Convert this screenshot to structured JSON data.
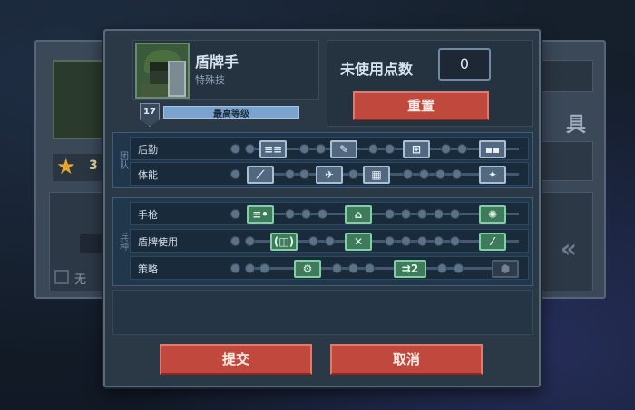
{
  "background": {
    "star_count": "3",
    "none_label": "无",
    "right_heading": "具"
  },
  "unit": {
    "name": "盾牌手",
    "subtitle": "特殊技",
    "level": "17",
    "level_label": "最高等级",
    "level_progress": 1.0
  },
  "points": {
    "label": "未使用点数",
    "value": "0",
    "reset_label": "重置"
  },
  "groups": [
    {
      "label": "团队",
      "rows": [
        {
          "name": "后勤",
          "nodes": [
            "≡≡",
            "✎",
            "⊞",
            "▪▪"
          ]
        },
        {
          "name": "体能",
          "nodes": [
            "⟋",
            "✈",
            "▦",
            "✦"
          ]
        }
      ]
    },
    {
      "label": "兵种",
      "rows": [
        {
          "name": "手枪",
          "nodes": [
            "≡•",
            "⌂",
            "✺"
          ]
        },
        {
          "name": "盾牌使用",
          "nodes": [
            "(◫)",
            "✕",
            "⁄"
          ]
        },
        {
          "name": "策略",
          "nodes": [
            "⚙",
            "⇉2",
            "⬢"
          ]
        }
      ]
    }
  ],
  "buttons": {
    "submit": "提交",
    "cancel": "取消"
  },
  "colors": {
    "button_red": "#c0483c",
    "level_bar": "#7aa3cf",
    "node_active": "#a8c0d6",
    "node_green": "#3f7a5c"
  }
}
